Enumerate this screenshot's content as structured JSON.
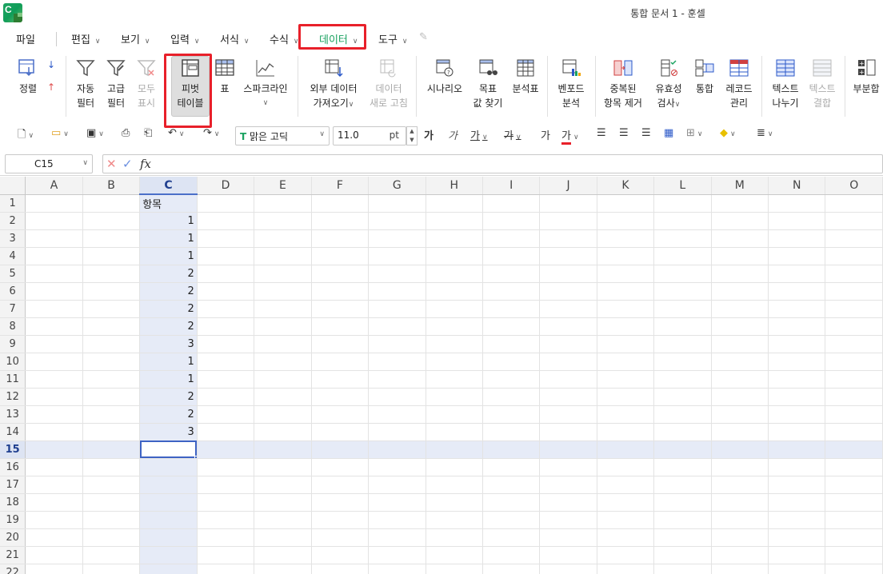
{
  "window": {
    "title": "통합 문서 1 - 훈셀",
    "app_icon_letter": "C"
  },
  "menubar": {
    "file": "파일",
    "items": [
      "편집",
      "보기",
      "입력",
      "서식",
      "수식",
      "데이터",
      "도구"
    ],
    "active": "데이터"
  },
  "ribbon": {
    "sort": "정렬",
    "auto_filter": [
      "자동",
      "필터"
    ],
    "adv_filter": [
      "고급",
      "필터"
    ],
    "show_all": [
      "모두",
      "표시"
    ],
    "pivot_table": [
      "피벗",
      "테이블"
    ],
    "table": "표",
    "sparkline": "스파크라인",
    "external_data": [
      "외부 데이터",
      "가져오기"
    ],
    "refresh_data": [
      "데이터",
      "새로 고침"
    ],
    "scenario": "시나리오",
    "goal_seek": [
      "목표",
      "값 찾기"
    ],
    "analysis_table": "분석표",
    "benford": [
      "벤포드",
      "분석"
    ],
    "remove_dup": [
      "중복된",
      "항목 제거"
    ],
    "validation": [
      "유효성",
      "검사"
    ],
    "consolidate": "통합",
    "record_manage": [
      "레코드",
      "관리"
    ],
    "text_split": [
      "텍스트",
      "나누기"
    ],
    "text_join": [
      "텍스트",
      "결합"
    ],
    "subtotal": "부분합"
  },
  "toolbar": {
    "font_name": "맑은 고딕",
    "font_size": "11.0",
    "font_unit": "pt",
    "bold_glyph": "가",
    "italic_glyph": "가",
    "underline_glyph": "가",
    "strike_glyph": "가",
    "size_glyph": "가",
    "color_glyph": "가"
  },
  "formula_bar": {
    "cell_ref": "C15",
    "fx": "fx",
    "content": ""
  },
  "grid": {
    "columns": [
      "A",
      "B",
      "C",
      "D",
      "E",
      "F",
      "G",
      "H",
      "I",
      "J",
      "K",
      "L",
      "M",
      "N",
      "O"
    ],
    "selected_column": "C",
    "selected_row": 15,
    "rows": [
      {
        "n": "1",
        "C": "항목"
      },
      {
        "n": "2",
        "C": "1"
      },
      {
        "n": "3",
        "C": "1"
      },
      {
        "n": "4",
        "C": "1"
      },
      {
        "n": "5",
        "C": "2"
      },
      {
        "n": "6",
        "C": "2"
      },
      {
        "n": "7",
        "C": "2"
      },
      {
        "n": "8",
        "C": "2"
      },
      {
        "n": "9",
        "C": "3"
      },
      {
        "n": "10",
        "C": "1"
      },
      {
        "n": "11",
        "C": "1"
      },
      {
        "n": "12",
        "C": "2"
      },
      {
        "n": "13",
        "C": "2"
      },
      {
        "n": "14",
        "C": "3"
      },
      {
        "n": "15",
        "C": ""
      },
      {
        "n": "16",
        "C": ""
      },
      {
        "n": "17",
        "C": ""
      },
      {
        "n": "18",
        "C": ""
      },
      {
        "n": "19",
        "C": ""
      },
      {
        "n": "20",
        "C": ""
      },
      {
        "n": "21",
        "C": ""
      },
      {
        "n": "22",
        "C": ""
      }
    ]
  },
  "colors": {
    "accent_green": "#1aa260",
    "highlight_red": "#e8202a",
    "selection_blue": "#3e63c4"
  }
}
